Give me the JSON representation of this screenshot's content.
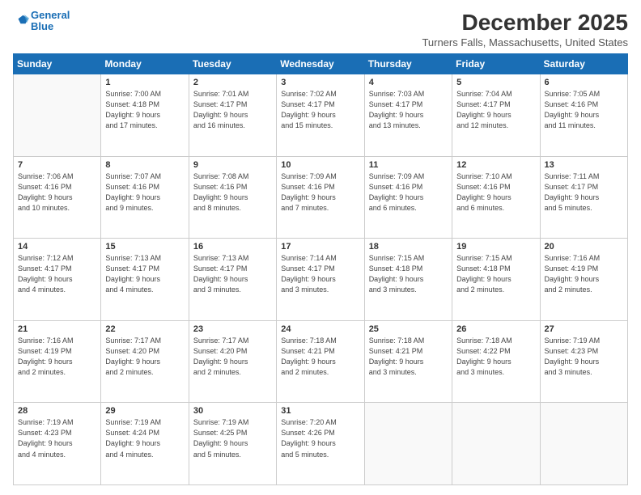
{
  "header": {
    "logo_line1": "General",
    "logo_line2": "Blue",
    "title": "December 2025",
    "subtitle": "Turners Falls, Massachusetts, United States"
  },
  "weekdays": [
    "Sunday",
    "Monday",
    "Tuesday",
    "Wednesday",
    "Thursday",
    "Friday",
    "Saturday"
  ],
  "weeks": [
    [
      {
        "day": "",
        "info": ""
      },
      {
        "day": "1",
        "info": "Sunrise: 7:00 AM\nSunset: 4:18 PM\nDaylight: 9 hours\nand 17 minutes."
      },
      {
        "day": "2",
        "info": "Sunrise: 7:01 AM\nSunset: 4:17 PM\nDaylight: 9 hours\nand 16 minutes."
      },
      {
        "day": "3",
        "info": "Sunrise: 7:02 AM\nSunset: 4:17 PM\nDaylight: 9 hours\nand 15 minutes."
      },
      {
        "day": "4",
        "info": "Sunrise: 7:03 AM\nSunset: 4:17 PM\nDaylight: 9 hours\nand 13 minutes."
      },
      {
        "day": "5",
        "info": "Sunrise: 7:04 AM\nSunset: 4:17 PM\nDaylight: 9 hours\nand 12 minutes."
      },
      {
        "day": "6",
        "info": "Sunrise: 7:05 AM\nSunset: 4:16 PM\nDaylight: 9 hours\nand 11 minutes."
      }
    ],
    [
      {
        "day": "7",
        "info": "Sunrise: 7:06 AM\nSunset: 4:16 PM\nDaylight: 9 hours\nand 10 minutes."
      },
      {
        "day": "8",
        "info": "Sunrise: 7:07 AM\nSunset: 4:16 PM\nDaylight: 9 hours\nand 9 minutes."
      },
      {
        "day": "9",
        "info": "Sunrise: 7:08 AM\nSunset: 4:16 PM\nDaylight: 9 hours\nand 8 minutes."
      },
      {
        "day": "10",
        "info": "Sunrise: 7:09 AM\nSunset: 4:16 PM\nDaylight: 9 hours\nand 7 minutes."
      },
      {
        "day": "11",
        "info": "Sunrise: 7:09 AM\nSunset: 4:16 PM\nDaylight: 9 hours\nand 6 minutes."
      },
      {
        "day": "12",
        "info": "Sunrise: 7:10 AM\nSunset: 4:16 PM\nDaylight: 9 hours\nand 6 minutes."
      },
      {
        "day": "13",
        "info": "Sunrise: 7:11 AM\nSunset: 4:17 PM\nDaylight: 9 hours\nand 5 minutes."
      }
    ],
    [
      {
        "day": "14",
        "info": "Sunrise: 7:12 AM\nSunset: 4:17 PM\nDaylight: 9 hours\nand 4 minutes."
      },
      {
        "day": "15",
        "info": "Sunrise: 7:13 AM\nSunset: 4:17 PM\nDaylight: 9 hours\nand 4 minutes."
      },
      {
        "day": "16",
        "info": "Sunrise: 7:13 AM\nSunset: 4:17 PM\nDaylight: 9 hours\nand 3 minutes."
      },
      {
        "day": "17",
        "info": "Sunrise: 7:14 AM\nSunset: 4:17 PM\nDaylight: 9 hours\nand 3 minutes."
      },
      {
        "day": "18",
        "info": "Sunrise: 7:15 AM\nSunset: 4:18 PM\nDaylight: 9 hours\nand 3 minutes."
      },
      {
        "day": "19",
        "info": "Sunrise: 7:15 AM\nSunset: 4:18 PM\nDaylight: 9 hours\nand 2 minutes."
      },
      {
        "day": "20",
        "info": "Sunrise: 7:16 AM\nSunset: 4:19 PM\nDaylight: 9 hours\nand 2 minutes."
      }
    ],
    [
      {
        "day": "21",
        "info": "Sunrise: 7:16 AM\nSunset: 4:19 PM\nDaylight: 9 hours\nand 2 minutes."
      },
      {
        "day": "22",
        "info": "Sunrise: 7:17 AM\nSunset: 4:20 PM\nDaylight: 9 hours\nand 2 minutes."
      },
      {
        "day": "23",
        "info": "Sunrise: 7:17 AM\nSunset: 4:20 PM\nDaylight: 9 hours\nand 2 minutes."
      },
      {
        "day": "24",
        "info": "Sunrise: 7:18 AM\nSunset: 4:21 PM\nDaylight: 9 hours\nand 2 minutes."
      },
      {
        "day": "25",
        "info": "Sunrise: 7:18 AM\nSunset: 4:21 PM\nDaylight: 9 hours\nand 3 minutes."
      },
      {
        "day": "26",
        "info": "Sunrise: 7:18 AM\nSunset: 4:22 PM\nDaylight: 9 hours\nand 3 minutes."
      },
      {
        "day": "27",
        "info": "Sunrise: 7:19 AM\nSunset: 4:23 PM\nDaylight: 9 hours\nand 3 minutes."
      }
    ],
    [
      {
        "day": "28",
        "info": "Sunrise: 7:19 AM\nSunset: 4:23 PM\nDaylight: 9 hours\nand 4 minutes."
      },
      {
        "day": "29",
        "info": "Sunrise: 7:19 AM\nSunset: 4:24 PM\nDaylight: 9 hours\nand 4 minutes."
      },
      {
        "day": "30",
        "info": "Sunrise: 7:19 AM\nSunset: 4:25 PM\nDaylight: 9 hours\nand 5 minutes."
      },
      {
        "day": "31",
        "info": "Sunrise: 7:20 AM\nSunset: 4:26 PM\nDaylight: 9 hours\nand 5 minutes."
      },
      {
        "day": "",
        "info": ""
      },
      {
        "day": "",
        "info": ""
      },
      {
        "day": "",
        "info": ""
      }
    ]
  ]
}
